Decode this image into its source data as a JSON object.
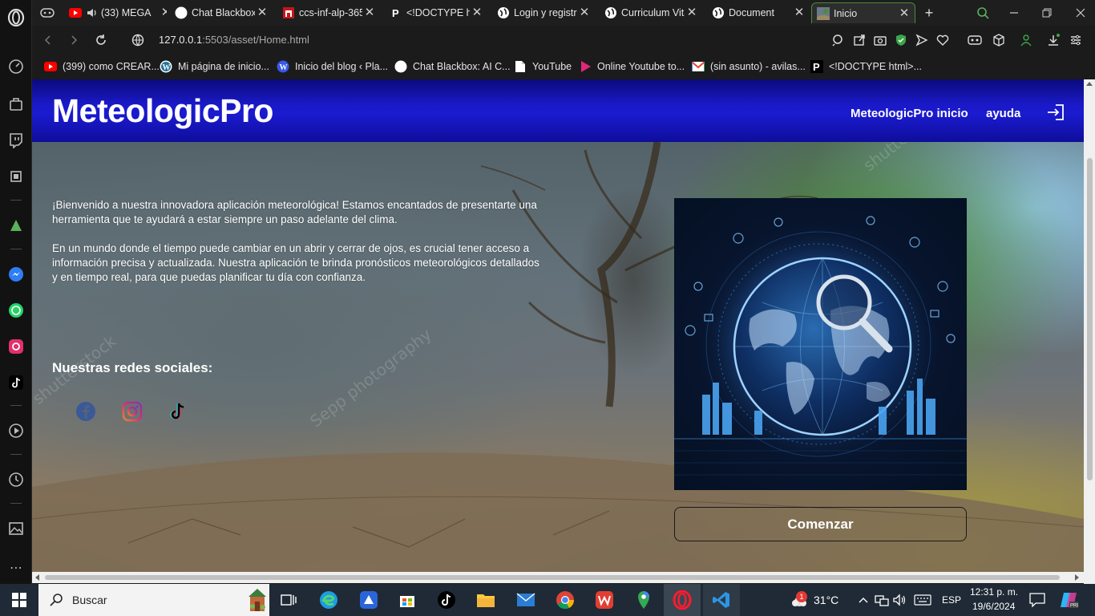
{
  "browser": {
    "tabs": [
      {
        "title": "(33) MEGA",
        "favicon": "youtube-icon",
        "active": false
      },
      {
        "title": "Chat Blackbox",
        "favicon": "blackbox-icon",
        "active": false
      },
      {
        "title": "ccs-inf-alp-365",
        "favicon": "castle-icon",
        "active": false
      },
      {
        "title": "<!DOCTYPE htm",
        "favicon": "p-icon",
        "active": false
      },
      {
        "title": "Login y registro",
        "favicon": "globe-icon",
        "active": false
      },
      {
        "title": "Curriculum Vita",
        "favicon": "globe-icon",
        "active": false
      },
      {
        "title": "Document",
        "favicon": "globe-icon",
        "active": false
      },
      {
        "title": "Inicio",
        "favicon": "landscape-icon",
        "active": true
      }
    ],
    "address": {
      "host": "127.0.0.1",
      "rest": ":5503/asset/Home.html"
    },
    "bookmarks": [
      {
        "label": "(399) como CREAR...",
        "favicon": "youtube-icon"
      },
      {
        "label": "Mi página de inicio...",
        "favicon": "wordpress-icon"
      },
      {
        "label": "Inicio del blog ‹ Pla...",
        "favicon": "wordpress-icon"
      },
      {
        "label": "Chat Blackbox: AI C...",
        "favicon": "blackbox-icon"
      },
      {
        "label": "YouTube",
        "favicon": "file-icon"
      },
      {
        "label": "Online Youtube to...",
        "favicon": "play-icon"
      },
      {
        "label": "(sin asunto) - avilas...",
        "favicon": "gmail-icon"
      },
      {
        "label": "<!DOCTYPE html>...",
        "favicon": "p-icon"
      }
    ]
  },
  "page": {
    "logo": "MeteologicPro",
    "nav": {
      "home": "MeteologicPro inicio",
      "help": "ayuda"
    },
    "intro": [
      "¡Bienvenido a nuestra innovadora aplicación meteorológica! Estamos encantados de presentarte una herramienta que te ayudará a estar siempre un paso adelante del clima.",
      "En un mundo donde el tiempo puede cambiar en un abrir y cerrar de ojos, es crucial tener acceso a información precisa y actualizada. Nuestra aplicación te brinda pronósticos meteorológicos detallados y en tiempo real, para que puedas planificar tu día con confianza."
    ],
    "social_title": "Nuestras redes sociales:",
    "start_button": "Comenzar",
    "watermarks": [
      "shutterstock",
      "Sepp photography",
      "shutterst"
    ]
  },
  "taskbar": {
    "search_placeholder": "Buscar",
    "weather": "31°C",
    "weather_badge": "1",
    "language": "ESP",
    "time": "12:31 p. m.",
    "date": "19/6/2024"
  },
  "colors": {
    "header": "#1b1bd0",
    "accent_green": "#4c8b3a"
  }
}
